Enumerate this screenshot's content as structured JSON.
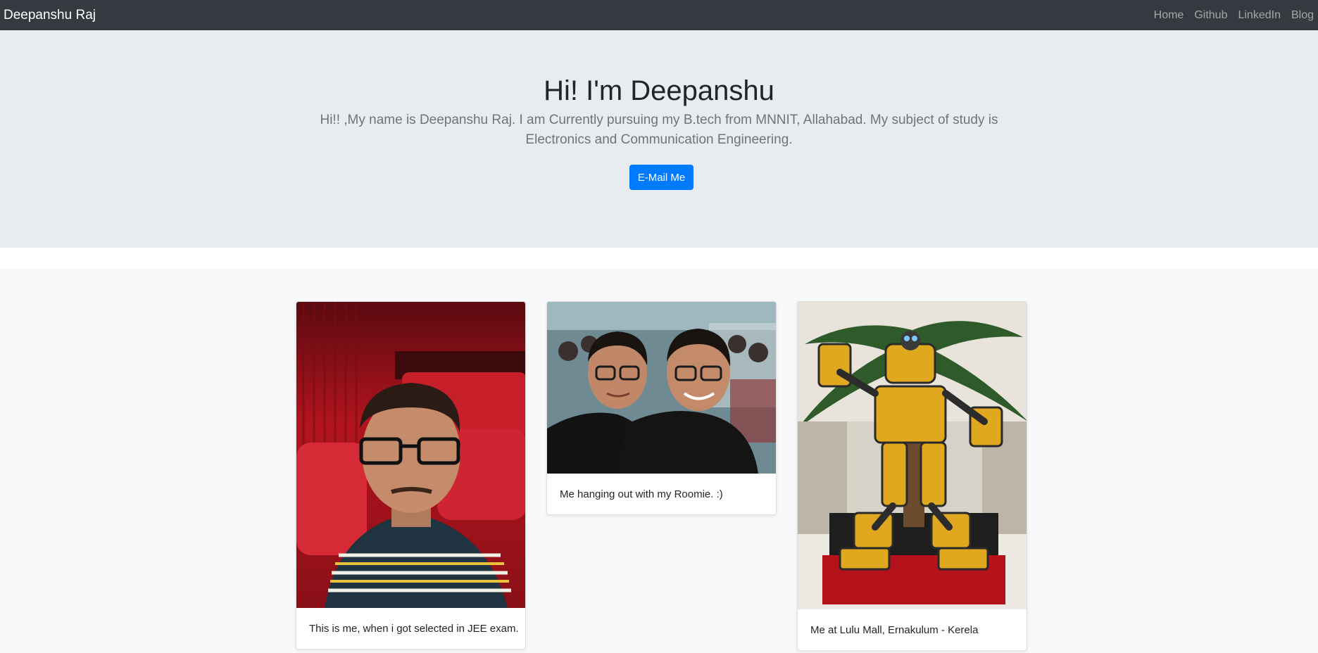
{
  "navbar": {
    "brand": "Deepanshu Raj",
    "links": [
      "Home",
      "Github",
      "LinkedIn",
      "Blog"
    ]
  },
  "hero": {
    "title": "Hi! I'm Deepanshu",
    "lead": "Hi!! ,My name is Deepanshu Raj. I am Currently pursuing my B.tech from MNNIT, Allahabad. My subject of study is Electronics and Communication Engineering.",
    "button_label": "E-Mail Me"
  },
  "cards": [
    {
      "caption": "This is me, when i got selected in JEE exam."
    },
    {
      "caption": "Me hanging out with my Roomie. :)"
    },
    {
      "caption": "Me at Lulu Mall, Ernakulum - Kerela"
    }
  ],
  "colors": {
    "navbar_bg": "#343a40",
    "hero_bg": "#e9ecef",
    "primary": "#007bff",
    "page_bg": "#f8f9fa"
  }
}
